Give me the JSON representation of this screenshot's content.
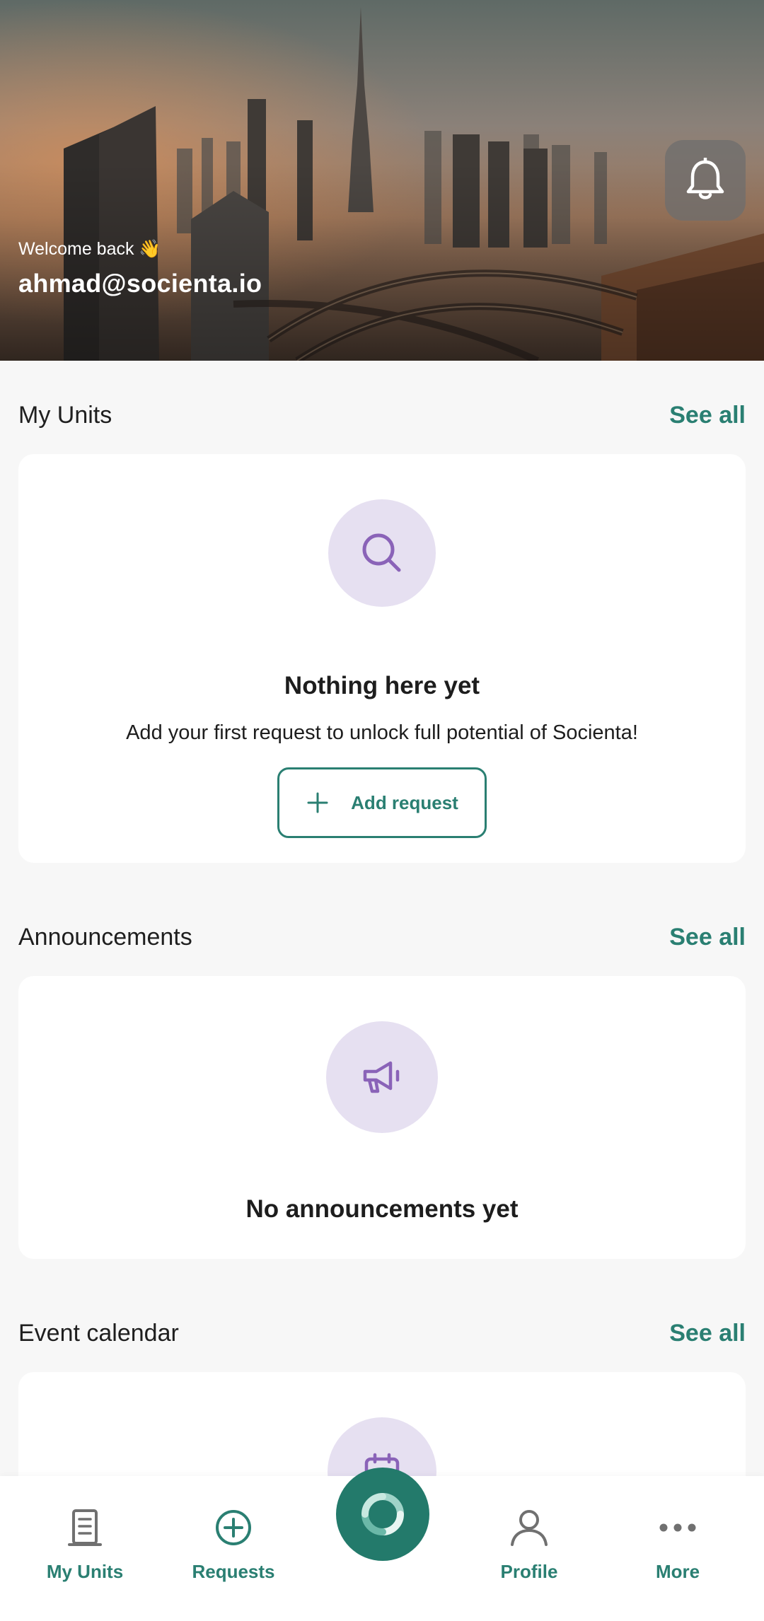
{
  "hero": {
    "welcome": "Welcome back 👋",
    "email": "ahmad@socienta.io",
    "bell_icon": "bell-icon"
  },
  "sections": {
    "units": {
      "title": "My Units",
      "see_all": "See all",
      "icon": "search-icon",
      "heading": "Nothing here yet",
      "subtitle": "Add your first request to unlock full potential of Socienta!",
      "button_label": "Add request"
    },
    "announcements": {
      "title": "Announcements",
      "see_all": "See all",
      "icon": "megaphone-icon",
      "heading": "No announcements yet"
    },
    "events": {
      "title": "Event calendar",
      "see_all": "See all",
      "icon": "calendar-icon"
    }
  },
  "nav": {
    "items": [
      {
        "label": "My Units",
        "icon": "building-icon"
      },
      {
        "label": "Requests",
        "icon": "plus-circle-icon"
      },
      {
        "label": "Profile",
        "icon": "user-icon"
      },
      {
        "label": "More",
        "icon": "more-dots-icon"
      }
    ],
    "center_icon": "app-logo-icon"
  },
  "colors": {
    "accent": "#2a7f72",
    "accent_dark": "#237a6b",
    "icon_bg": "#e6e0f1",
    "icon_fg": "#8a63b8",
    "background": "#f7f7f7"
  }
}
